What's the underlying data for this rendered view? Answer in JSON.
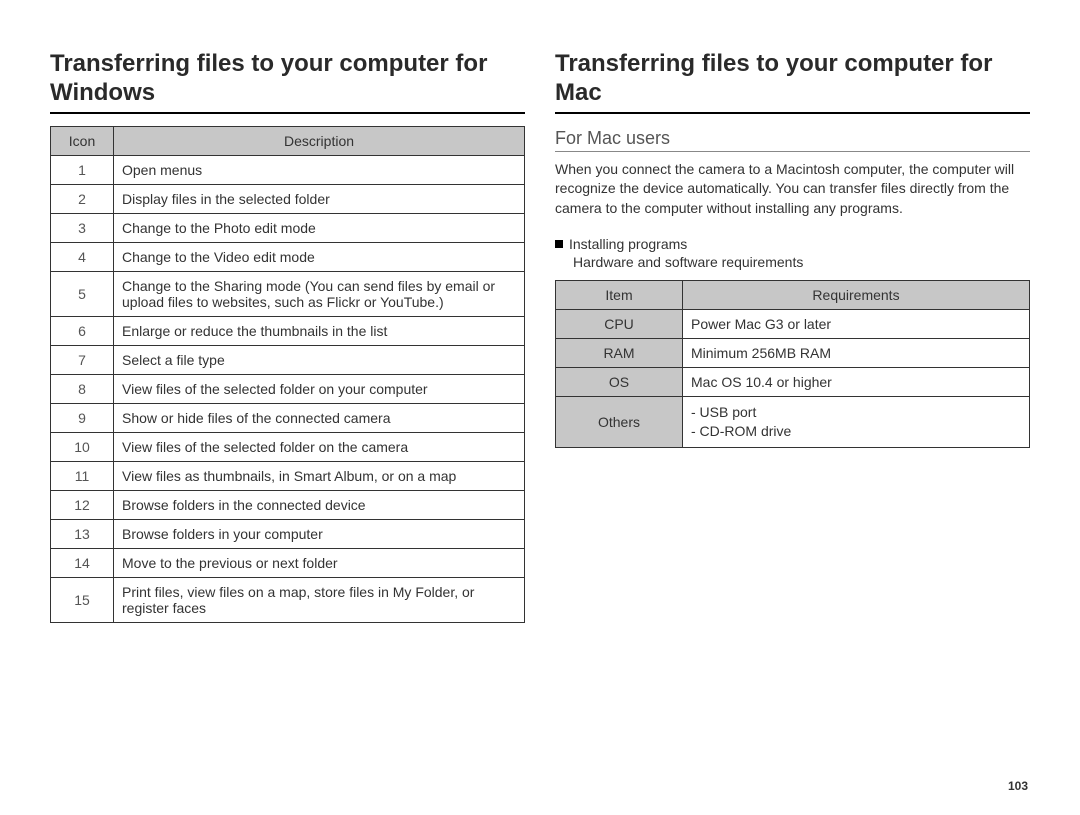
{
  "page_number": "103",
  "left": {
    "heading": "Transferring files to your computer for Windows",
    "table": {
      "headers": {
        "icon": "Icon",
        "desc": "Description"
      },
      "rows": [
        {
          "icon": "1",
          "desc": "Open menus"
        },
        {
          "icon": "2",
          "desc": "Display files in the selected folder"
        },
        {
          "icon": "3",
          "desc": "Change to the Photo edit mode"
        },
        {
          "icon": "4",
          "desc": "Change to the Video edit mode"
        },
        {
          "icon": "5",
          "desc": "Change to the Sharing mode (You can send files by email or upload files to websites, such as Flickr or YouTube.)"
        },
        {
          "icon": "6",
          "desc": "Enlarge or reduce the thumbnails in the list"
        },
        {
          "icon": "7",
          "desc": "Select a file type"
        },
        {
          "icon": "8",
          "desc": "View files of the selected folder on your computer"
        },
        {
          "icon": "9",
          "desc": "Show or hide files of the connected camera"
        },
        {
          "icon": "10",
          "desc": "View files of the selected folder on the camera"
        },
        {
          "icon": "11",
          "desc": "View files as thumbnails, in Smart Album, or on a map"
        },
        {
          "icon": "12",
          "desc": "Browse folders in the connected device"
        },
        {
          "icon": "13",
          "desc": "Browse folders in your computer"
        },
        {
          "icon": "14",
          "desc": "Move to the previous or next folder"
        },
        {
          "icon": "15",
          "desc": "Print files, view files on a map, store files in My Folder, or register faces"
        }
      ]
    }
  },
  "right": {
    "heading": "Transferring files to your computer for Mac",
    "subheading": "For Mac users",
    "paragraph": "When you connect the camera to a Macintosh computer, the computer will recognize the device automatically. You can transfer files directly from the camera to the computer without installing any programs.",
    "bullet": "Installing programs",
    "subline": "Hardware and software requirements",
    "req_table": {
      "headers": {
        "item": "Item",
        "req": "Requirements"
      },
      "rows": [
        {
          "item": "CPU",
          "req": "Power Mac G3 or later"
        },
        {
          "item": "RAM",
          "req": "Minimum 256MB RAM"
        },
        {
          "item": "OS",
          "req": "Mac OS 10.4 or higher"
        },
        {
          "item": "Others",
          "req": "- USB port\n- CD-ROM drive"
        }
      ]
    }
  }
}
